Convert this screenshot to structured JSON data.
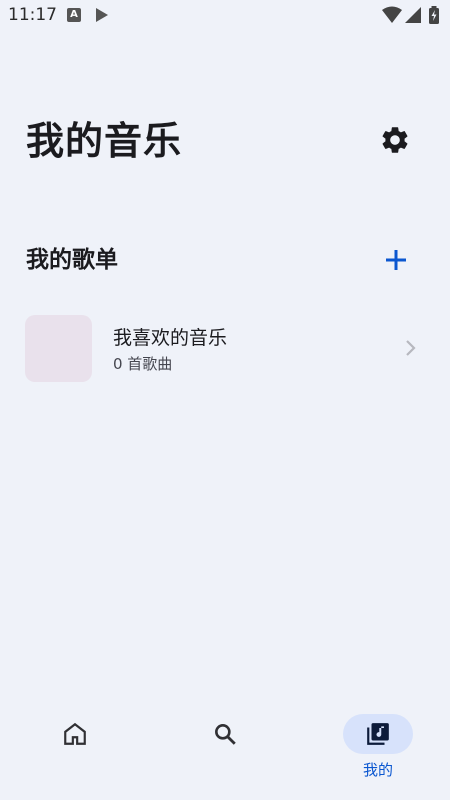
{
  "status_bar": {
    "time": "11:17",
    "notification_icons": [
      "a-badge-icon",
      "play-store-icon"
    ],
    "system_icons": [
      "wifi-icon",
      "signal-icon",
      "battery-icon"
    ],
    "a_badge_text": "A"
  },
  "header": {
    "title": "我的音乐",
    "settings_icon": "gear-icon"
  },
  "playlists_section": {
    "title": "我的歌单",
    "add_icon": "plus-icon",
    "items": [
      {
        "name": "我喜欢的音乐",
        "count": "0 首歌曲"
      }
    ]
  },
  "bottom_nav": {
    "items": [
      {
        "icon": "home-icon",
        "label": "",
        "selected": false
      },
      {
        "icon": "search-icon",
        "label": "",
        "selected": false
      },
      {
        "icon": "music-library-icon",
        "label": "我的",
        "selected": true
      }
    ]
  },
  "colors": {
    "background": "#eff2f9",
    "accent": "#0b57d0",
    "selected_pill": "#d7e2fb",
    "cover_placeholder": "#e9e1ec",
    "text_primary": "#1b1b1f",
    "text_secondary": "#45464f"
  }
}
